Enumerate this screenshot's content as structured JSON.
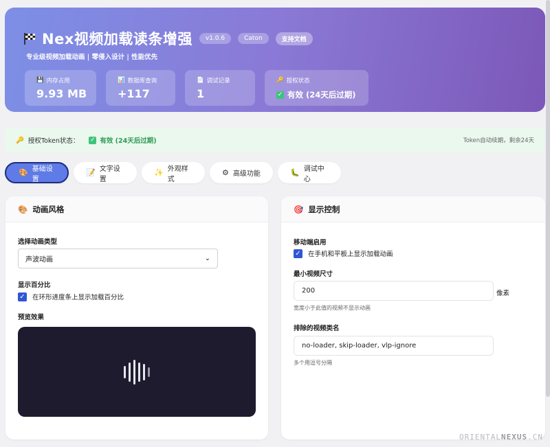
{
  "header": {
    "title": "Nex视频加载读条增强",
    "version": "v1.0.6",
    "author": "Caton",
    "docs_link": "支持文档",
    "subtitle": "专业级视频加载动画 | 零侵入设计 | 性能优先",
    "stats": [
      {
        "icon": "disk-icon",
        "label": "内存占用",
        "value": "9.93 MB"
      },
      {
        "icon": "database-icon",
        "label": "数据库查询",
        "value": "+117"
      },
      {
        "icon": "log-icon",
        "label": "调试记录",
        "value": "1"
      },
      {
        "icon": "key-icon",
        "label": "授权状态",
        "value": "有效 (24天后过期)"
      }
    ]
  },
  "token": {
    "label": "授权Token状态：",
    "status": "有效 (24天后过期)",
    "right": "Token自动续期，剩余24天"
  },
  "tabs": [
    {
      "icon": "palette-icon",
      "label": "基础设置",
      "active": true
    },
    {
      "icon": "text-icon",
      "label": "文字设置"
    },
    {
      "icon": "sparkle-icon",
      "label": "外观样式"
    },
    {
      "icon": "gear-icon",
      "label": "高级功能"
    },
    {
      "icon": "bug-icon",
      "label": "调试中心"
    }
  ],
  "left_panel": {
    "title": "动画风格",
    "anim_type_label": "选择动画类型",
    "anim_type_value": "声波动画",
    "show_percent_label": "显示百分比",
    "show_percent_check": "在环形进度条上显示加载百分比",
    "preview_label": "预览效果"
  },
  "right_panel": {
    "title": "显示控制",
    "mobile_label": "移动端启用",
    "mobile_check": "在手机和平板上显示加载动画",
    "min_size_label": "最小视频尺寸",
    "min_size_value": "200",
    "min_size_unit": "像素",
    "min_size_hint": "宽度小于此值的视频不显示动画",
    "exclude_label": "排除的视频类名",
    "exclude_value": "no-loader, skip-loader, vlp-ignore",
    "exclude_hint": "多个用逗号分隔"
  },
  "watermark": {
    "prefix": "ORIENTAL",
    "bold": "NEXUS",
    "suffix": ".CN"
  },
  "colors": {
    "accent": "#5f7be7",
    "success": "#2f9a52",
    "preview_bg": "#1d1b2d"
  }
}
